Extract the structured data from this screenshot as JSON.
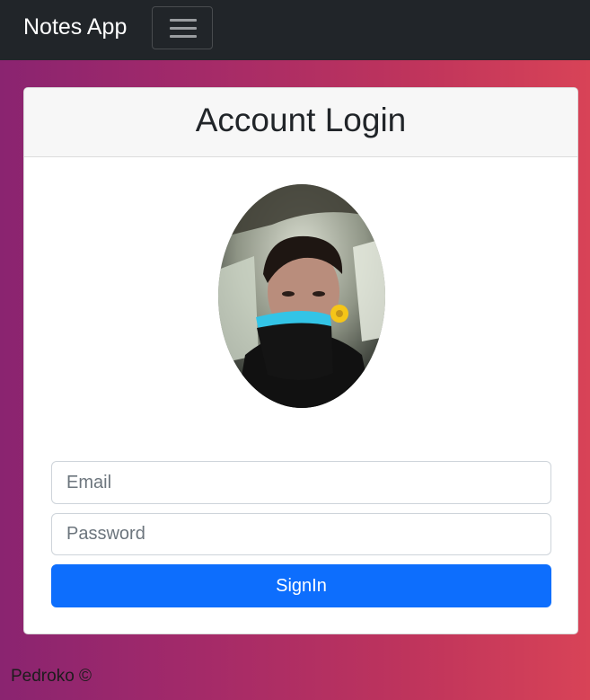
{
  "navbar": {
    "brand": "Notes App",
    "menu_icon": "hamburger-menu-icon"
  },
  "login": {
    "title": "Account Login",
    "avatar_alt": "profile-photo",
    "email_placeholder": "Email",
    "password_placeholder": "Password",
    "submit_label": "SignIn"
  },
  "footer": {
    "text": "Pedroko ©"
  },
  "colors": {
    "navbar_bg": "#212529",
    "primary_button": "#0d6efd",
    "gradient_start": "#8a2470",
    "gradient_end": "#d84357"
  }
}
